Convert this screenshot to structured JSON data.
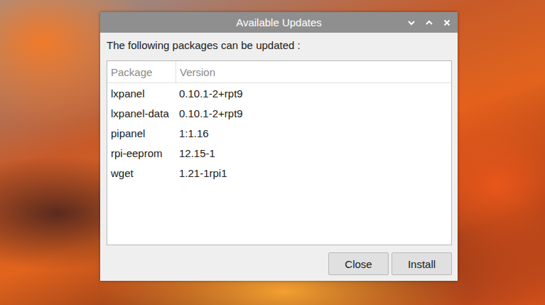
{
  "window": {
    "title": "Available Updates"
  },
  "message": "The following packages can be updated :",
  "table": {
    "columns": [
      "Package",
      "Version"
    ],
    "rows": [
      {
        "package": "lxpanel",
        "version": "0.10.1-2+rpt9"
      },
      {
        "package": "lxpanel-data",
        "version": "0.10.1-2+rpt9"
      },
      {
        "package": "pipanel",
        "version": "1:1.16"
      },
      {
        "package": "rpi-eeprom",
        "version": "12.15-1"
      },
      {
        "package": "wget",
        "version": "1.21-1rpi1"
      }
    ]
  },
  "buttons": [
    "Close",
    "Install"
  ]
}
